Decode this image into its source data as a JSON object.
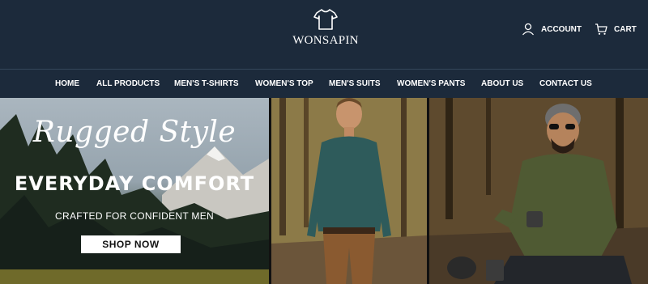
{
  "brand": {
    "name": "WONSAPIN",
    "logo_icon": "tshirt-icon"
  },
  "header": {
    "account": {
      "label": "ACCOUNT",
      "icon": "user-icon"
    },
    "cart": {
      "label": "CART",
      "icon": "cart-icon"
    }
  },
  "nav": [
    {
      "label": "HOME"
    },
    {
      "label": "ALL PRODUCTS"
    },
    {
      "label": "MEN'S T-SHIRTS"
    },
    {
      "label": "WOMEN'S TOP"
    },
    {
      "label": "MEN'S SUITS"
    },
    {
      "label": "WOMEN'S PANTS"
    },
    {
      "label": "ABOUT US"
    },
    {
      "label": "CONTACT US"
    }
  ],
  "hero": {
    "script_title": "Rugged Style",
    "headline": "EVERYDAY COMFORT",
    "subline": "CRAFTED FOR CONFIDENT MEN",
    "cta": "SHOP NOW"
  },
  "colors": {
    "header_bg": "#1c2a3b",
    "text": "#ffffff",
    "button_bg": "#ffffff",
    "button_text": "#111111"
  }
}
